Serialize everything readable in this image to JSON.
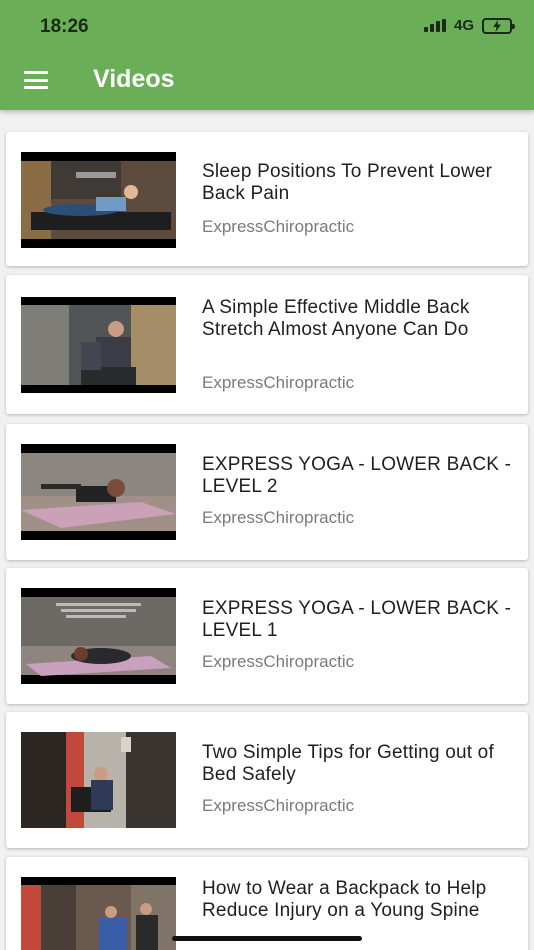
{
  "status_bar": {
    "time": "18:26",
    "network": "4G"
  },
  "header": {
    "title": "Videos",
    "menu_icon": "hamburger-menu-icon"
  },
  "colors": {
    "header": "#6aaf57",
    "background": "#f1f1f1",
    "title_text": "#1f1f1f",
    "channel_text": "#7a7a7a"
  },
  "videos": [
    {
      "title": "Sleep Positions To Prevent Lower Back Pain",
      "channel": "ExpressChiropractic"
    },
    {
      "title": "A Simple Effective Middle Back Stretch Almost Anyone Can Do",
      "channel": "ExpressChiropractic"
    },
    {
      "title": "EXPRESS YOGA - LOWER BACK - LEVEL 2",
      "channel": "ExpressChiropractic"
    },
    {
      "title": "EXPRESS YOGA - LOWER BACK - LEVEL 1",
      "channel": "ExpressChiropractic"
    },
    {
      "title": "Two Simple Tips for Getting out of Bed Safely",
      "channel": "ExpressChiropractic"
    },
    {
      "title": "How to Wear a Backpack to Help Reduce Injury on a Young Spine",
      "channel": ""
    }
  ]
}
